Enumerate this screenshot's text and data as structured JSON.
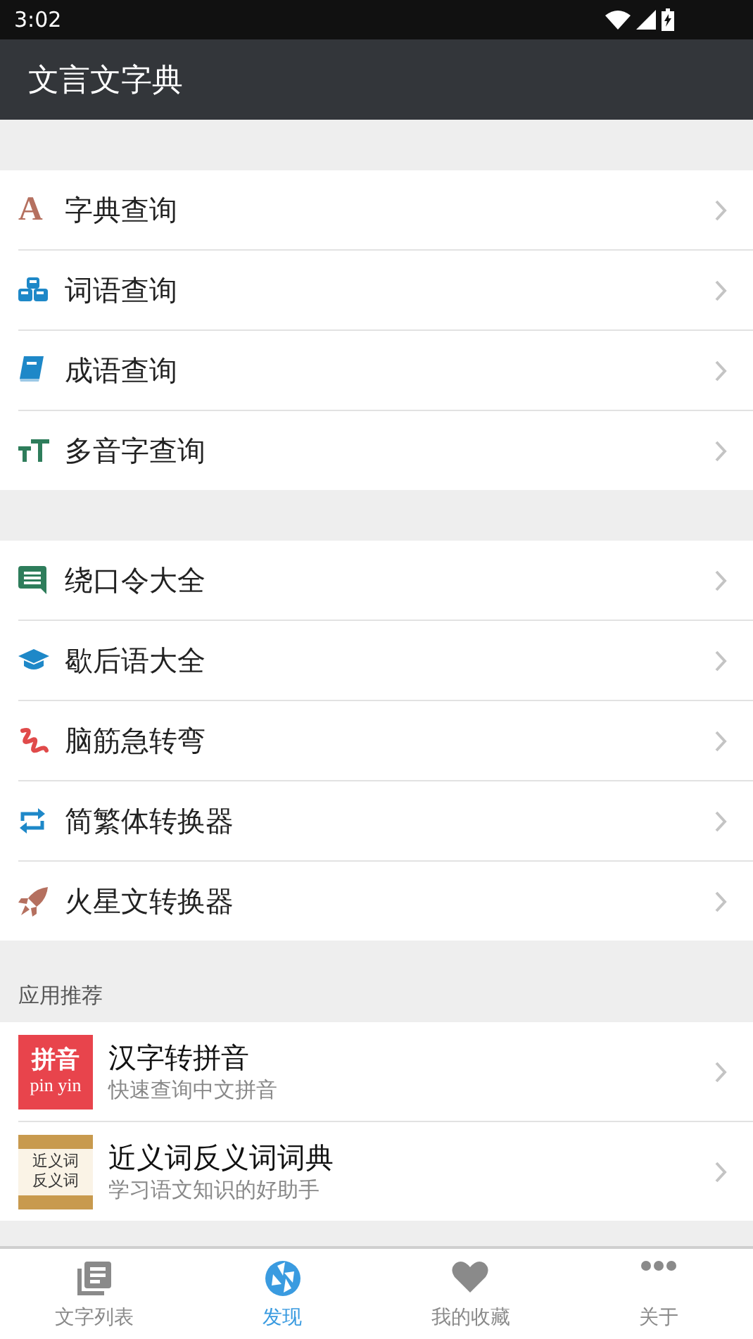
{
  "status_bar": {
    "time": "3:02"
  },
  "app_bar": {
    "title": "文言文字典"
  },
  "groups": [
    {
      "items": [
        {
          "label": "字典查询",
          "kind": "glyph",
          "glyph": "A"
        },
        {
          "label": "词语查询",
          "kind": "cubes"
        },
        {
          "label": "成语查询",
          "kind": "book"
        },
        {
          "label": "多音字查询",
          "kind": "text-size"
        }
      ]
    },
    {
      "items": [
        {
          "label": "绕口令大全",
          "kind": "chat"
        },
        {
          "label": "歇后语大全",
          "kind": "cap"
        },
        {
          "label": "脑筋急转弯",
          "kind": "squiggle"
        },
        {
          "label": "简繁体转换器",
          "kind": "swap"
        },
        {
          "label": "火星文转换器",
          "kind": "rocket"
        }
      ]
    }
  ],
  "recommend": {
    "heading": "应用推荐",
    "apps": [
      {
        "name": "汉字转拼音",
        "desc": "快速查询中文拼音",
        "kind": "pinyin",
        "logo_lines": [
          "拼音",
          "pin yin"
        ]
      },
      {
        "name": "近义词反义词词典",
        "desc": "学习语文知识的好助手",
        "kind": "synonym",
        "logo_lines": [
          "近义词",
          "反义词"
        ]
      }
    ]
  },
  "bottom_nav": [
    {
      "label": "文字列表",
      "kind": "list",
      "selected": false
    },
    {
      "label": "发现",
      "kind": "aperture",
      "selected": true
    },
    {
      "label": "我的收藏",
      "kind": "heart",
      "selected": false
    },
    {
      "label": "关于",
      "kind": "more",
      "selected": false
    }
  ]
}
